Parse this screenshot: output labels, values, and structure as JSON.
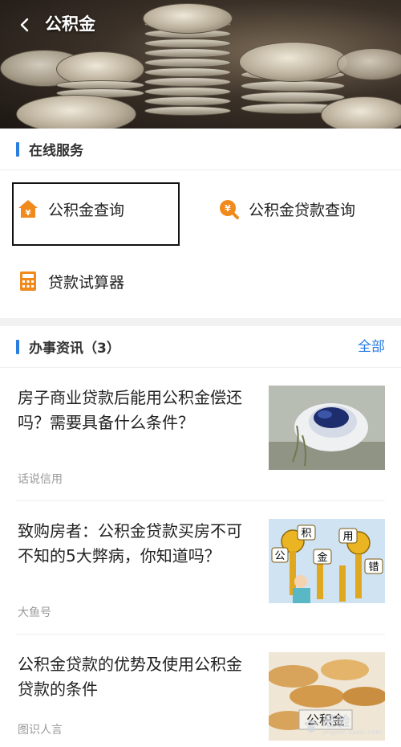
{
  "header": {
    "title": "公积金",
    "back_icon": "back-arrow-icon"
  },
  "services": {
    "title": "在线服务",
    "items": [
      {
        "label": "公积金查询",
        "icon": "house-yen-icon",
        "color": "#f08a1d"
      },
      {
        "label": "公积金贷款查询",
        "icon": "search-yen-icon",
        "color": "#f08a1d"
      },
      {
        "label": "贷款试算器",
        "icon": "calculator-icon",
        "color": "#f08a1d"
      }
    ]
  },
  "news": {
    "title": "办事资讯（3）",
    "more_label": "全部",
    "items": [
      {
        "title": "房子商业贷款后能用公积金偿还吗？需要具备什么条件？",
        "source": "话说信用"
      },
      {
        "title": "致购房者：公积金贷款买房不可不知的5大弊病，你知道吗？",
        "source": "大鱼号"
      },
      {
        "title": "公积金贷款的优势及使用公积金贷款的条件",
        "source": "图识人言"
      }
    ]
  },
  "thumb_captions": {
    "keys": [
      "积",
      "用",
      "公",
      "金",
      "错"
    ],
    "coins_label": "公积金"
  },
  "watermark": {
    "text": "经验",
    "sub": "jingyan.baidu.com"
  },
  "colors": {
    "accent": "#2a7de1",
    "icon_orange": "#f08a1d"
  }
}
